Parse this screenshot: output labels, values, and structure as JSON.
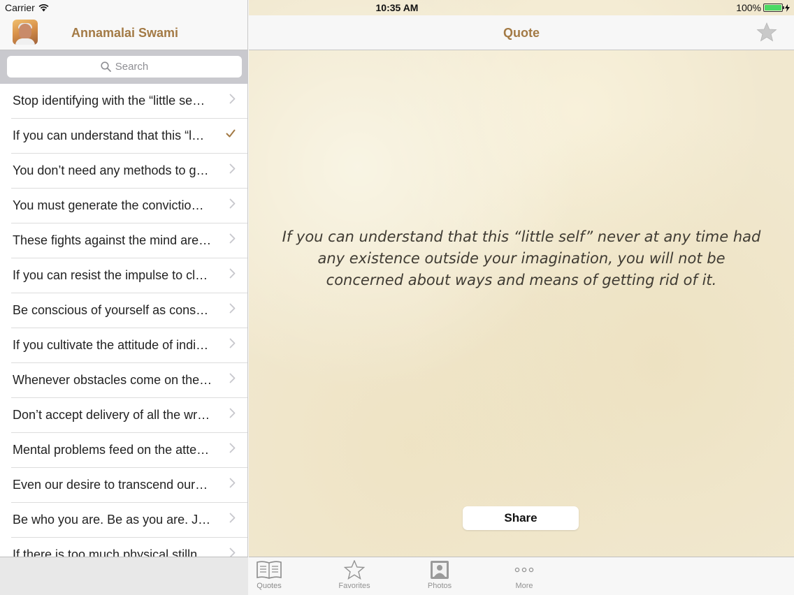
{
  "status_bar": {
    "carrier": "Carrier",
    "time": "10:35 AM",
    "battery": "100%",
    "battery_level": 1.0
  },
  "master": {
    "title": "Annamalai Swami",
    "search_placeholder": "Search",
    "items": [
      {
        "text": "Stop identifying with the “little se…",
        "accessory": "chevron"
      },
      {
        "text": "If you can understand that this “l…",
        "accessory": "check"
      },
      {
        "text": "You don’t need any methods to g…",
        "accessory": "chevron"
      },
      {
        "text": "You must generate the convictio…",
        "accessory": "chevron"
      },
      {
        "text": "These fights against the mind are…",
        "accessory": "chevron"
      },
      {
        "text": "If you can resist the impulse to cl…",
        "accessory": "chevron"
      },
      {
        "text": "Be conscious of yourself as cons…",
        "accessory": "chevron"
      },
      {
        "text": "If you cultivate the attitude of indi…",
        "accessory": "chevron"
      },
      {
        "text": "Whenever obstacles come on the…",
        "accessory": "chevron"
      },
      {
        "text": "Don’t accept delivery of all the wr…",
        "accessory": "chevron"
      },
      {
        "text": "Mental problems feed on the atte…",
        "accessory": "chevron"
      },
      {
        "text": "Even our desire to transcend our…",
        "accessory": "chevron"
      },
      {
        "text": "Be who you are. Be as you are. J…",
        "accessory": "chevron"
      },
      {
        "text": "If there is too much physical stilln…",
        "accessory": "chevron"
      }
    ]
  },
  "detail": {
    "title": "Quote",
    "quote": "If you can understand that this “little self” never at any time had any existence outside your imagination, you will not be concerned about ways and means of getting rid of it.",
    "share_label": "Share"
  },
  "tabs": [
    {
      "label": "Quotes",
      "icon": "book-icon"
    },
    {
      "label": "Favorites",
      "icon": "star-icon"
    },
    {
      "label": "Photos",
      "icon": "portrait-icon"
    },
    {
      "label": "More",
      "icon": "more-icon"
    }
  ],
  "colors": {
    "accent": "#a37a45",
    "parchment": "#f1e8cf",
    "battery_green": "#4cd964"
  }
}
